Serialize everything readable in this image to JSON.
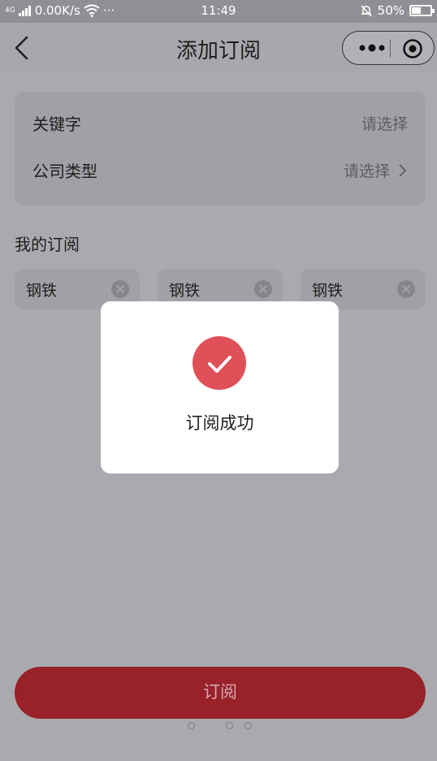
{
  "status_bar": {
    "network": "4G",
    "speed": "0.00K/s",
    "more": "···",
    "time": "11:49",
    "battery": "50%",
    "battery_level": 0.5
  },
  "nav": {
    "title": "添加订阅",
    "icons": [
      "back-arrow-icon",
      "more-dots-icon",
      "target-icon"
    ]
  },
  "form": {
    "rows": [
      {
        "label": "关键字",
        "value": "请选择",
        "has_chevron": false
      },
      {
        "label": "公司类型",
        "value": "请选择",
        "has_chevron": true
      }
    ]
  },
  "subscriptions": {
    "title": "我的订阅",
    "tags": [
      {
        "text": "钢铁"
      },
      {
        "text": "钢铁"
      },
      {
        "text": "钢铁"
      }
    ]
  },
  "toast": {
    "icon": "check-circle-icon",
    "text": "订阅成功"
  },
  "submit": {
    "label": "订阅"
  },
  "colors": {
    "accent": "#98212a",
    "success": "#e05059",
    "overlay": "#a9aaae"
  }
}
